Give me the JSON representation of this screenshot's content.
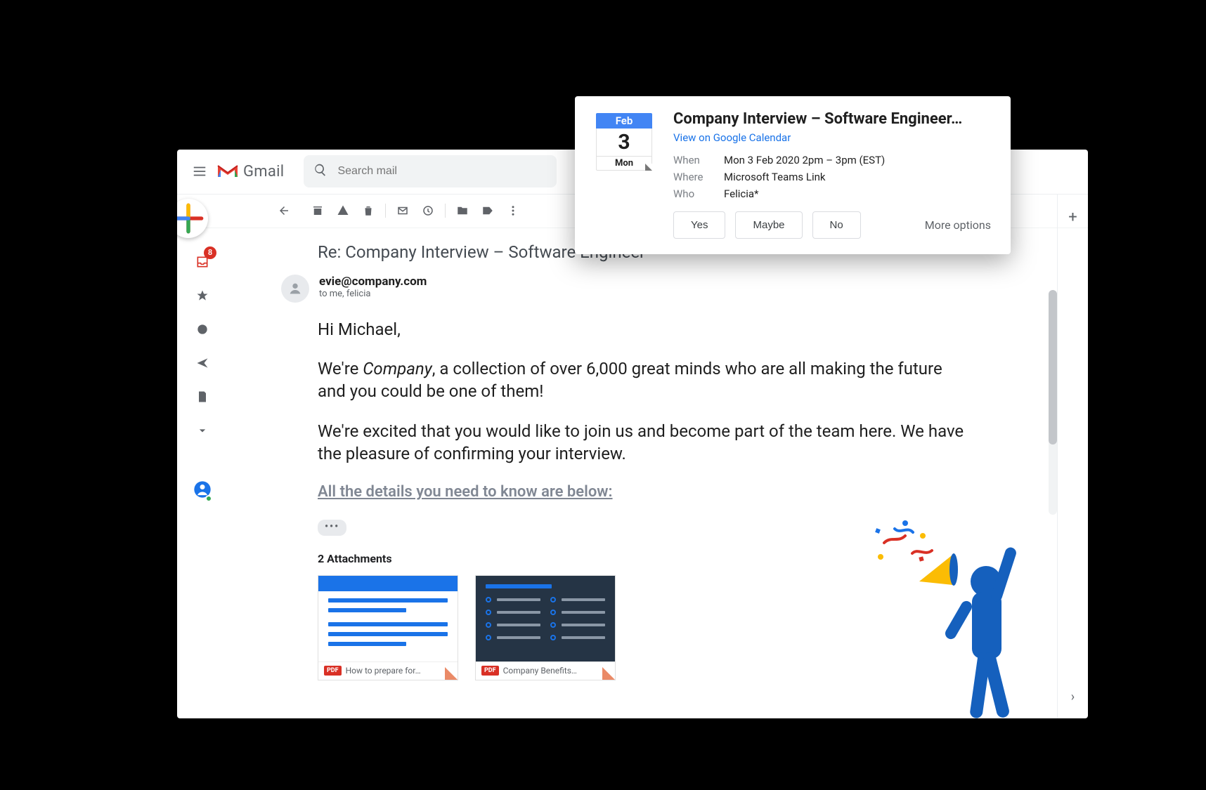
{
  "brand": {
    "name": "Gmail"
  },
  "search": {
    "placeholder": "Search mail"
  },
  "leftRail": {
    "inboxBadge": "8"
  },
  "actions": {
    "back": "Back",
    "archive": "Archive",
    "spam": "Report spam",
    "delete": "Delete",
    "unread": "Mark unread",
    "snooze": "Snooze",
    "move": "Move to",
    "labels": "Labels",
    "more": "More"
  },
  "rightRail": {
    "add": "+",
    "expand": "›"
  },
  "email": {
    "subject": "Re: Company Interview – Software Engineer",
    "sender": "evie@company.com",
    "recipients": "to me, felicia",
    "greeting": "Hi Michael,",
    "p1_a": "We're ",
    "p1_company": "Company",
    "p1_b": ", a collection of over 6,000 great minds who are all making the future and you could be one of them!",
    "p2": "We're excited that you would like to join us and become part of the team here. We have the pleasure of confirming your interview.",
    "detailsHead": "All the details you need to know are below:",
    "trimmed": "•••",
    "attachmentsTitle": "2 Attachments",
    "attachments": [
      {
        "badge": "PDF",
        "name": "How to prepare for…"
      },
      {
        "badge": "PDF",
        "name": "Company Benefits…"
      }
    ]
  },
  "calendar": {
    "month": "Feb",
    "day": "3",
    "weekday": "Mon",
    "title": "Company Interview – Software Engineer…",
    "viewLink": "View on Google Calendar",
    "whenLabel": "When",
    "when": "Mon 3 Feb 2020 2pm – 3pm (EST)",
    "whereLabel": "Where",
    "where": "Microsoft Teams Link",
    "whoLabel": "Who",
    "who": "Felicia*",
    "yes": "Yes",
    "maybe": "Maybe",
    "no": "No",
    "more": "More options"
  }
}
